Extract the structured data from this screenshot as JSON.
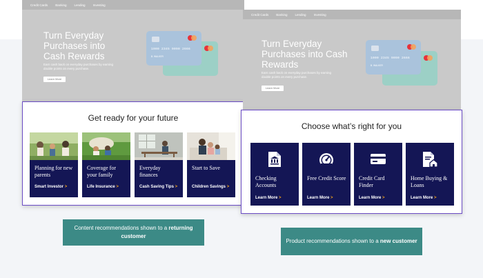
{
  "left": {
    "nav": [
      "Credit Cards",
      "Banking",
      "Lending",
      "Investing"
    ],
    "hero_title": "Turn Everyday Purchases into Cash Rewards",
    "hero_sub": "Earn cash back on everyday purchases by earning double points on every purchase.",
    "hero_button": "Learn More",
    "card_number": "1000 2345 9090 2666",
    "card_name": "B. WALKER",
    "panel_title": "Get ready for your future",
    "tiles": [
      {
        "title": "Planning for new parents",
        "link": "Smart Investor"
      },
      {
        "title": "Coverage for your family",
        "link": "Life Insurance"
      },
      {
        "title": "Everyday finances",
        "link": "Cash Saving Tips"
      },
      {
        "title": "Start to Save",
        "link": "Children Savings"
      }
    ],
    "caption_prefix": "Content recommendations shown to a ",
    "caption_strong": "returning customer"
  },
  "right": {
    "nav": [
      "Credit Cards",
      "Banking",
      "Lending",
      "Investing"
    ],
    "hero_title": "Turn Everyday Purchases into Cash Rewards",
    "hero_sub": "Earn cash back on everyday purchases by earning double points on every purchase.",
    "hero_button": "Learn More",
    "card_number": "1000 2345 9090 2666",
    "card_name": "B. WALKER",
    "panel_title": "Choose what’s right for you",
    "tiles": [
      {
        "title": "Checking Accounts",
        "link": "Learn More",
        "icon": "bank-document-icon"
      },
      {
        "title": "Free Credit Score",
        "link": "Learn More",
        "icon": "gauge-icon"
      },
      {
        "title": "Credit Card Finder",
        "link": "Learn More",
        "icon": "credit-card-icon"
      },
      {
        "title": "Home Buying & Loans",
        "link": "Learn More",
        "icon": "house-document-icon"
      }
    ],
    "caption_prefix": "Product recommendations shown to a ",
    "caption_strong": "new customer"
  },
  "link_arrow": ">"
}
